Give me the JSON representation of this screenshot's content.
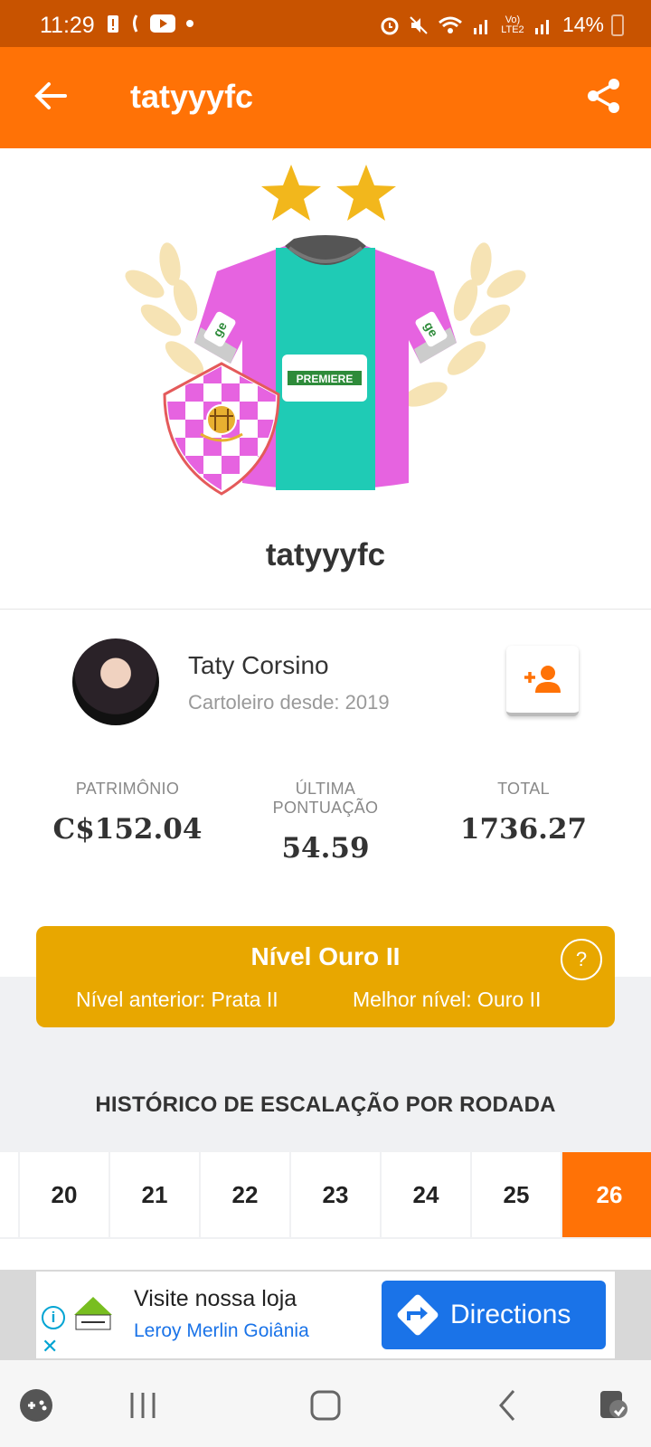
{
  "status_bar": {
    "time": "11:29",
    "battery": "14%",
    "lte": "Vo) LTE2"
  },
  "app_bar": {
    "title": "tatyyyfc",
    "back_icon": "arrow-left-icon",
    "share_icon": "share-icon"
  },
  "team": {
    "name": "tatyyyfc",
    "sponsor": "PREMIERE",
    "sleeve_logo": "ge",
    "stars": 2,
    "colors": {
      "jersey_pink": "#e663e0",
      "jersey_teal": "#1fcbb5",
      "laurel": "#f6e3b4",
      "star": "#f2b71c"
    }
  },
  "profile": {
    "user_name": "Taty Corsino",
    "since": "Cartoleiro desde: 2019",
    "follow_icon": "add-person-icon"
  },
  "stats": [
    {
      "label": "PATRIMÔNIO",
      "value": "C$152.04"
    },
    {
      "label": "ÚLTIMA PONTUAÇÃO",
      "value": "54.59"
    },
    {
      "label": "TOTAL",
      "value": "1736.27"
    }
  ],
  "level": {
    "title": "Nível Ouro II",
    "previous": "Nível anterior: Prata II",
    "best": "Melhor nível: Ouro II",
    "help": "?"
  },
  "history": {
    "title": "HISTÓRICO DE ESCALAÇÃO POR RODADA",
    "rounds": [
      "20",
      "21",
      "22",
      "23",
      "24",
      "25",
      "26"
    ],
    "active_round": "26"
  },
  "ad": {
    "headline": "Visite nossa loja",
    "subline": "Leroy Merlin Goiânia",
    "cta": "Directions",
    "info": "i",
    "close": "✕"
  },
  "colors": {
    "primary": "#ff7206",
    "status_bar": "#c85300",
    "gold": "#e8a700",
    "ad_blue": "#1a73e8"
  }
}
